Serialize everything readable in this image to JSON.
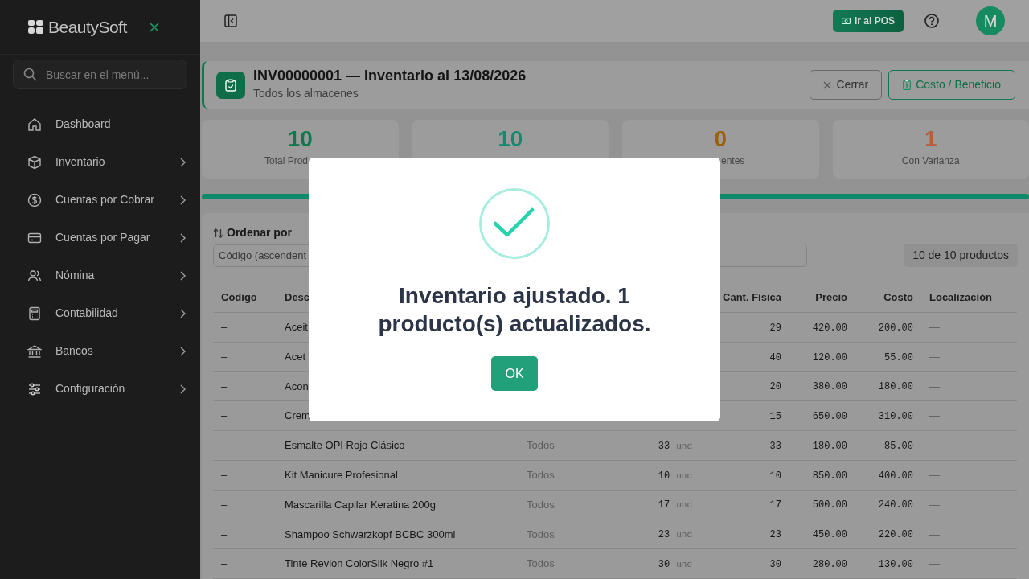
{
  "sidebar": {
    "brand": "BeautySoft",
    "search": {
      "placeholder": "Buscar en el menú..."
    },
    "items": [
      {
        "label": "Dashboard",
        "has_submenu": false
      },
      {
        "label": "Inventario",
        "has_submenu": true
      },
      {
        "label": "Cuentas por Cobrar",
        "has_submenu": true
      },
      {
        "label": "Cuentas por Pagar",
        "has_submenu": true
      },
      {
        "label": "Nómina",
        "has_submenu": true
      },
      {
        "label": "Contabilidad",
        "has_submenu": true
      },
      {
        "label": "Bancos",
        "has_submenu": true
      },
      {
        "label": "Configuración",
        "has_submenu": true
      }
    ]
  },
  "topbar": {
    "pos_button": "Ir al POS",
    "avatar": "M"
  },
  "header": {
    "title": "INV00000001 — Inventario al 13/08/2026",
    "subtitle": "Todos los almacenes",
    "buttons": [
      {
        "label": "Cerrar",
        "kind": "close"
      },
      {
        "label": "Costo / Beneficio",
        "kind": "cost"
      }
    ]
  },
  "stats": [
    {
      "value": "10",
      "label": "Total Prod",
      "color": "#10784f"
    },
    {
      "value": "10",
      "color": "#138a6c"
    },
    {
      "value": "0",
      "label": "entes",
      "color": "#9a6200"
    },
    {
      "value": "1",
      "label": "Con Varianza",
      "color": "#b85d3e"
    }
  ],
  "progress": {
    "level": 1
  },
  "filters": {
    "sort_label": "Ordenar por",
    "sort_value": "Código (ascendent",
    "count": "10 de 10 productos"
  },
  "table": {
    "columns": {
      "code": "Código",
      "description": "Desc",
      "physical_qty": "Cant. Física",
      "price": "Precio",
      "cost": "Costo",
      "location": "Localización"
    },
    "rows": [
      {
        "code": "–",
        "description": "Aceit",
        "physical_qty": "29",
        "price": "420.00",
        "cost": "200.00",
        "location": "—"
      },
      {
        "code": "–",
        "description": "Acet",
        "physical_qty": "40",
        "price": "120.00",
        "cost": "55.00",
        "location": "—"
      },
      {
        "code": "–",
        "description": "Acon",
        "physical_qty": "20",
        "price": "380.00",
        "cost": "180.00",
        "location": "—"
      },
      {
        "code": "–",
        "description": "Crem",
        "physical_qty": "15",
        "price": "650.00",
        "cost": "310.00",
        "location": "—"
      },
      {
        "code": "–",
        "description": "Esmalte OPI Rojo Clásico",
        "warehouse": "Todos",
        "system_qty": "33",
        "unit": "und",
        "physical_qty": "33",
        "price": "180.00",
        "cost": "85.00",
        "location": "—"
      },
      {
        "code": "–",
        "description": "Kit Manicure Profesional",
        "warehouse": "Todos",
        "system_qty": "10",
        "unit": "und",
        "physical_qty": "10",
        "price": "850.00",
        "cost": "400.00",
        "location": "—"
      },
      {
        "code": "–",
        "description": "Mascarilla Capilar Keratina 200g",
        "warehouse": "Todos",
        "system_qty": "17",
        "unit": "und",
        "physical_qty": "17",
        "price": "500.00",
        "cost": "240.00",
        "location": "—"
      },
      {
        "code": "–",
        "description": "Shampoo Schwarzkopf BCBC 300ml",
        "warehouse": "Todos",
        "system_qty": "23",
        "unit": "und",
        "physical_qty": "23",
        "price": "450.00",
        "cost": "220.00",
        "location": "—"
      },
      {
        "code": "–",
        "description": "Tinte Revlon ColorSilk Negro #1",
        "warehouse": "Todos",
        "system_qty": "30",
        "unit": "und",
        "physical_qty": "30",
        "price": "280.00",
        "cost": "130.00",
        "location": "—"
      }
    ]
  },
  "dialog": {
    "message": "Inventario ajustado. 1 producto(s) actualizados.",
    "button": "OK"
  }
}
